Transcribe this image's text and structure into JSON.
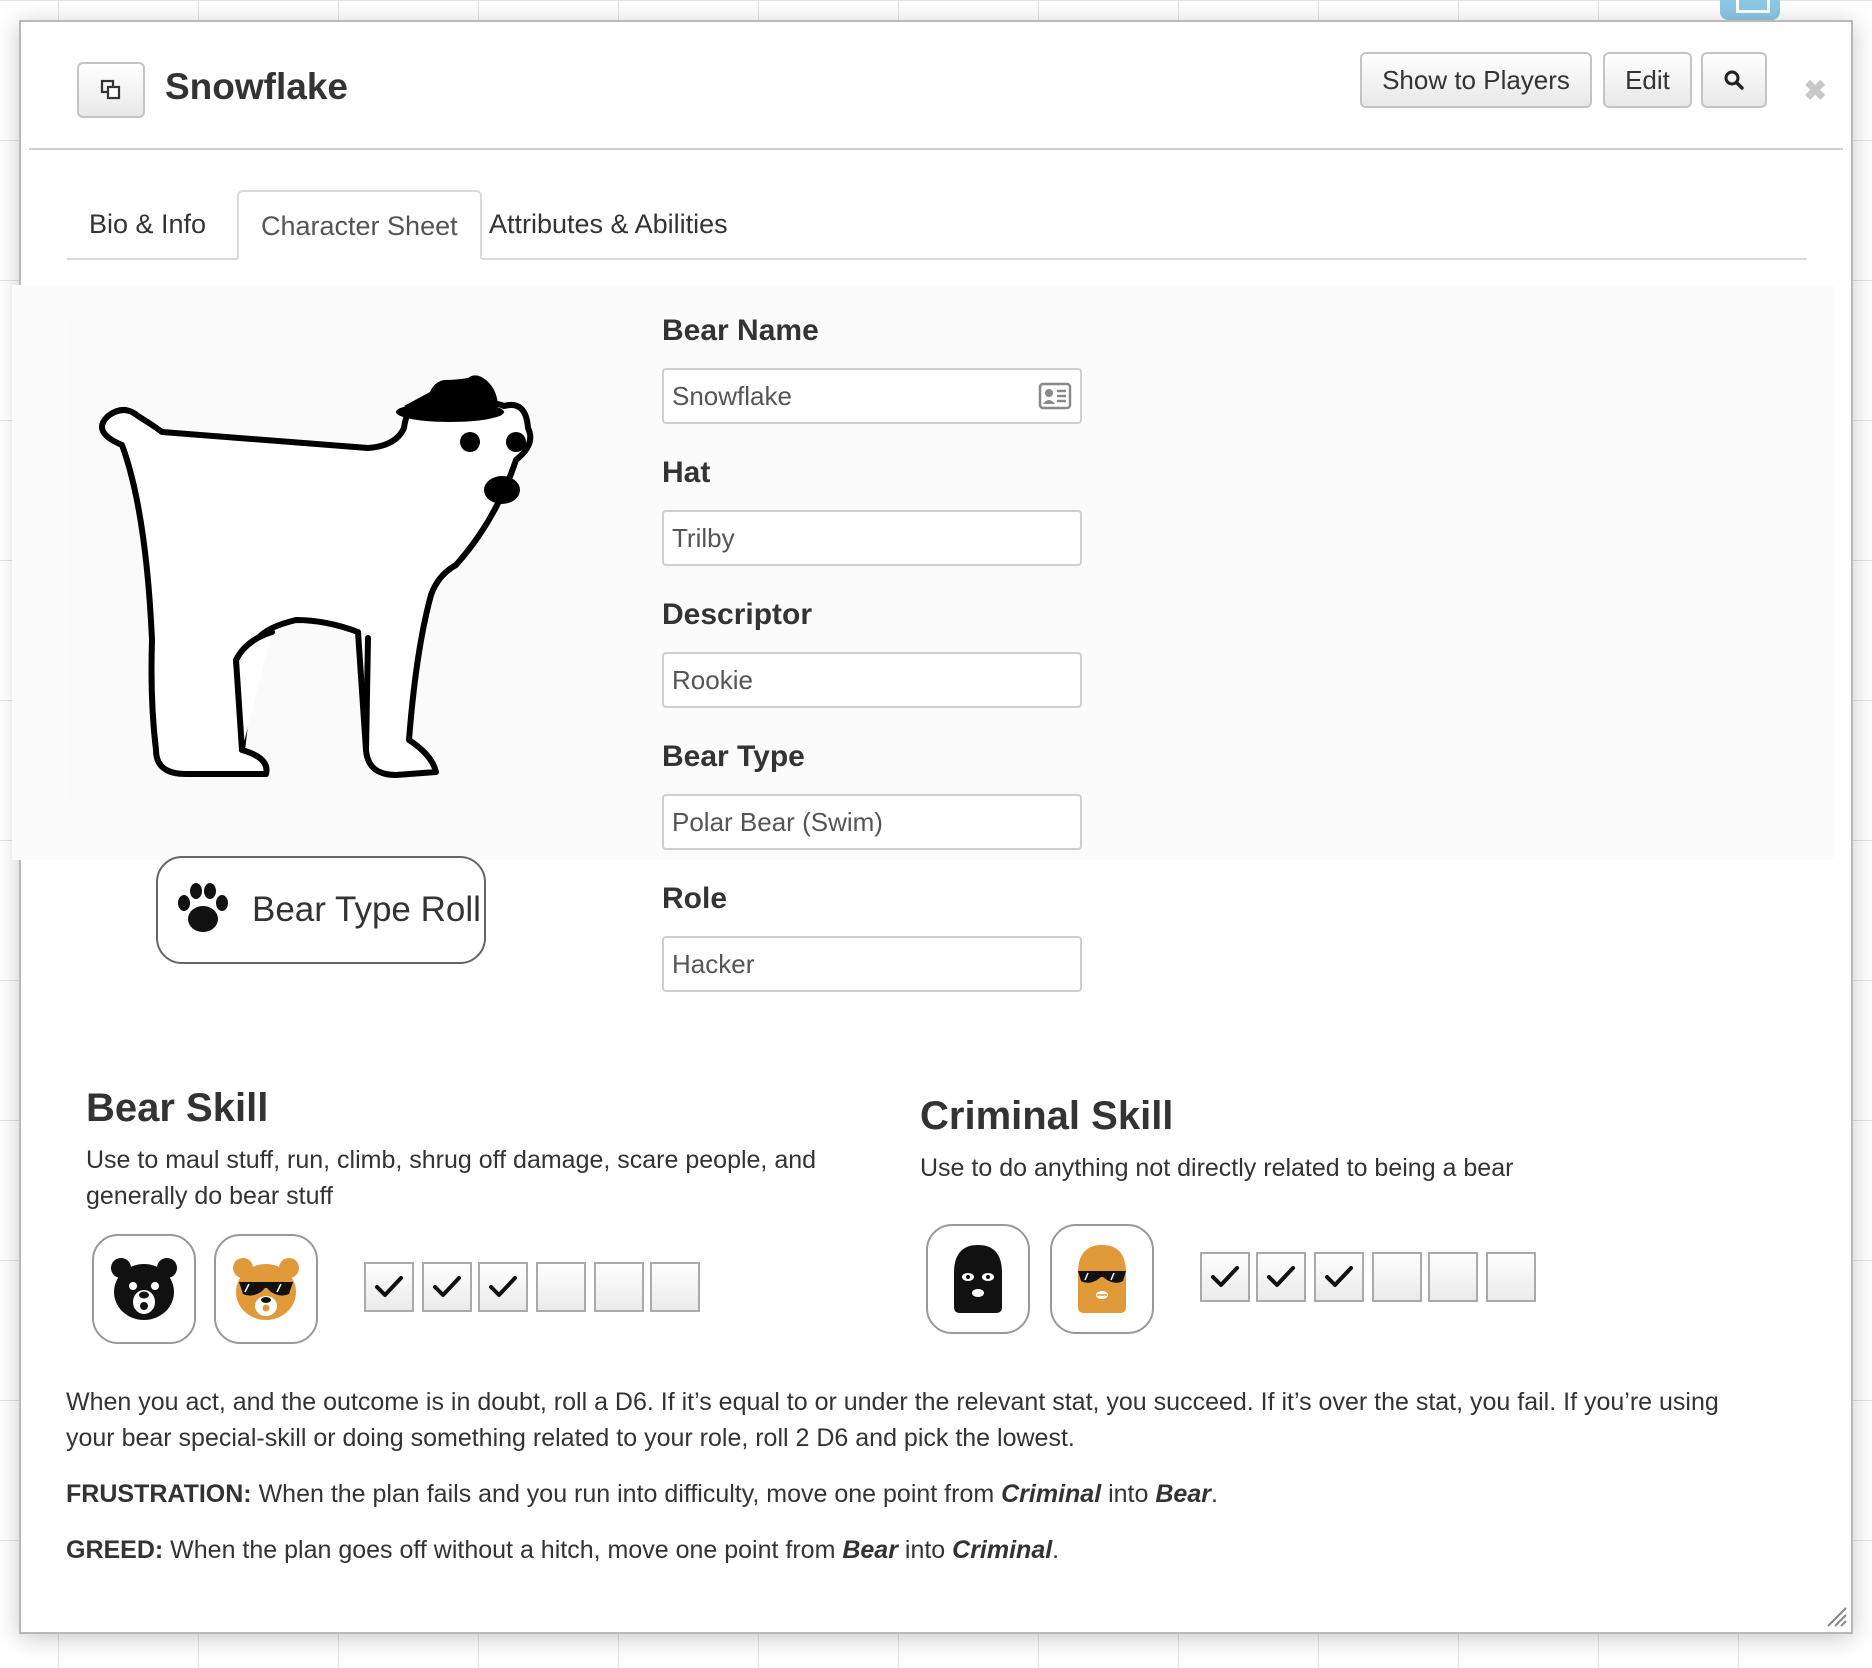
{
  "dialog": {
    "title": "Snowflake",
    "buttons": {
      "show_players": "Show to Players",
      "edit": "Edit"
    }
  },
  "tabs": [
    {
      "label": "Bio & Info",
      "active": false
    },
    {
      "label": "Character Sheet",
      "active": true
    },
    {
      "label": "Attributes & Abilities",
      "active": false
    }
  ],
  "fields": {
    "bear_name": {
      "label": "Bear Name",
      "value": "Snowflake"
    },
    "hat": {
      "label": "Hat",
      "value": "Trilby"
    },
    "descriptor": {
      "label": "Descriptor",
      "value": "Rookie"
    },
    "bear_type": {
      "label": "Bear Type",
      "value": "Polar Bear (Swim)"
    },
    "role": {
      "label": "Role",
      "value": "Hacker"
    }
  },
  "roll_button": {
    "label": "Bear Type Roll",
    "icon": "paw-icon"
  },
  "bear_skill": {
    "title": "Bear Skill",
    "description": "Use to maul stuff, run, climb, shrug off damage, scare people, and generally do bear stuff",
    "checked": [
      true,
      true,
      true,
      false,
      false,
      false
    ],
    "icons": [
      "bear-face-icon",
      "bear-sunglasses-icon"
    ]
  },
  "criminal_skill": {
    "title": "Criminal Skill",
    "description": "Use to do anything not directly related to being a bear",
    "checked": [
      true,
      true,
      true,
      false,
      false,
      false
    ],
    "icons": [
      "balaclava-icon",
      "balaclava-sunglasses-icon"
    ]
  },
  "rules": {
    "main": "When you act, and the outcome is in doubt, roll a D6. If it’s equal to or under the relevant stat, you succeed. If it’s over the stat, you fail. If you’re using your bear special-skill or doing something related to your role, roll 2 D6 and pick the lowest.",
    "frustration": {
      "label": "FRUSTRATION:",
      "text_a": " When the plan fails and you run into difficulty, move one point from ",
      "em_a": "Criminal",
      "text_b": " into ",
      "em_b": "Bear",
      "text_c": "."
    },
    "greed": {
      "label": "GREED:",
      "text_a": " When the plan goes off without a hitch, move one point from ",
      "em_a": "Bear",
      "text_b": " into ",
      "em_b": "Criminal",
      "text_c": "."
    }
  },
  "colors": {
    "accent_orange": "#e09a3a",
    "token_blue": "#8cc8e6"
  }
}
